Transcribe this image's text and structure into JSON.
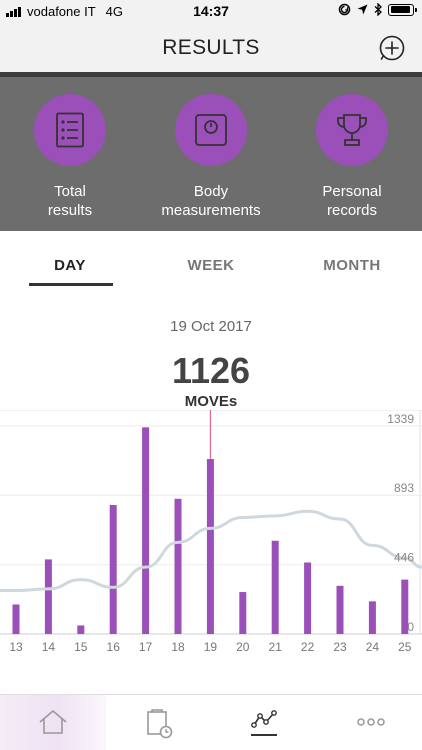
{
  "status_bar": {
    "carrier": "vodafone IT",
    "network": "4G",
    "time": "14:37",
    "icons": [
      "signal-icon",
      "location-lock-icon",
      "location-arrow-icon",
      "bluetooth-icon",
      "battery-icon"
    ]
  },
  "nav": {
    "title": "RESULTS",
    "add_icon": "plus-circle-icon"
  },
  "categories": [
    {
      "label_line1": "Total",
      "label_line2": "results",
      "icon": "list-icon"
    },
    {
      "label_line1": "Body",
      "label_line2": "measurements",
      "icon": "scale-icon"
    },
    {
      "label_line1": "Personal",
      "label_line2": "records",
      "icon": "trophy-icon"
    }
  ],
  "tabs": [
    {
      "label": "DAY",
      "active": true
    },
    {
      "label": "WEEK",
      "active": false
    },
    {
      "label": "MONTH",
      "active": false
    }
  ],
  "summary": {
    "date": "19 Oct 2017",
    "value": "1126",
    "unit": "MOVEs"
  },
  "chart_data": {
    "type": "bar",
    "categories": [
      "13",
      "14",
      "15",
      "16",
      "17",
      "18",
      "19",
      "20",
      "21",
      "22",
      "23",
      "24",
      "25"
    ],
    "values": [
      190,
      480,
      55,
      830,
      1330,
      870,
      1126,
      270,
      600,
      460,
      310,
      210,
      350
    ],
    "trend": [
      280,
      290,
      350,
      300,
      430,
      590,
      680,
      750,
      760,
      790,
      740,
      570,
      490
    ],
    "selected_index": 6,
    "y_ticks": [
      0,
      446,
      893,
      1339
    ],
    "ylim": [
      0,
      1390
    ],
    "bar_color": "#9b4fb8",
    "trend_color": "#cfd8de",
    "marker_color": "#e06a8f",
    "grid": true
  },
  "bottom_bar": {
    "items": [
      "home-icon",
      "activity-log-icon",
      "results-graph-icon",
      "more-icon"
    ],
    "active": 2
  },
  "colors": {
    "accent": "#9b4fb8",
    "category_bg": "#6d6d6d"
  }
}
